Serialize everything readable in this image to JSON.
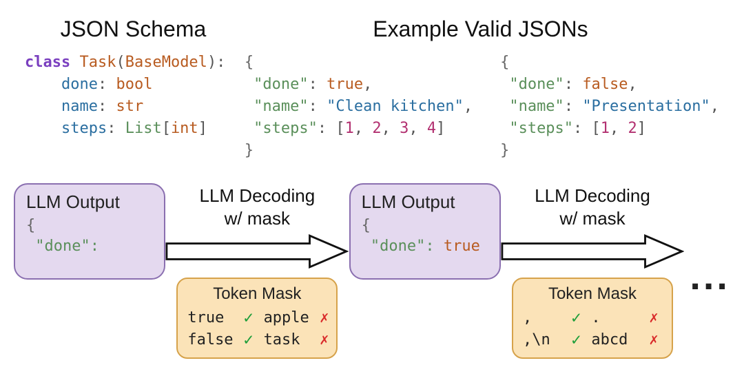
{
  "headings": {
    "schema": "JSON Schema",
    "examples": "Example Valid JSONs"
  },
  "schema_code": {
    "keyword_class": "class",
    "class_name": "Task",
    "base_class": "BaseModel",
    "fields": [
      {
        "name": "done",
        "type": "bool"
      },
      {
        "name": "name",
        "type": "str"
      },
      {
        "name": "steps",
        "type_outer": "List",
        "type_inner": "int"
      }
    ]
  },
  "examples": [
    {
      "done_key": "\"done\"",
      "done_val": "true",
      "name_key": "\"name\"",
      "name_val": "\"Clean kitchen\"",
      "steps_key": "\"steps\"",
      "steps_vals": [
        "1",
        "2",
        "3",
        "4"
      ]
    },
    {
      "done_key": "\"done\"",
      "done_val": "false",
      "name_key": "\"name\"",
      "name_val": "\"Presentation\"",
      "steps_key": "\"steps\"",
      "steps_vals": [
        "1",
        "2"
      ]
    }
  ],
  "flow": {
    "llm_output_title": "LLM Output",
    "arrow_label_line1": "LLM Decoding",
    "arrow_label_line2": "w/ mask",
    "token_mask_title": "Token Mask",
    "ellipsis": "..."
  },
  "step1": {
    "content_brace": "{",
    "content_line": "\"done\":",
    "mask": [
      {
        "ok_tok": "true",
        "bad_tok": "apple"
      },
      {
        "ok_tok": "false",
        "bad_tok": "task"
      }
    ]
  },
  "step2": {
    "content_brace": "{",
    "content_key": "\"done\":",
    "content_val": "true",
    "mask": [
      {
        "ok_tok": ",",
        "bad_tok": "."
      },
      {
        "ok_tok": ",\\n",
        "bad_tok": "abcd"
      }
    ]
  },
  "glyphs": {
    "check": "✓",
    "cross": "✗"
  }
}
